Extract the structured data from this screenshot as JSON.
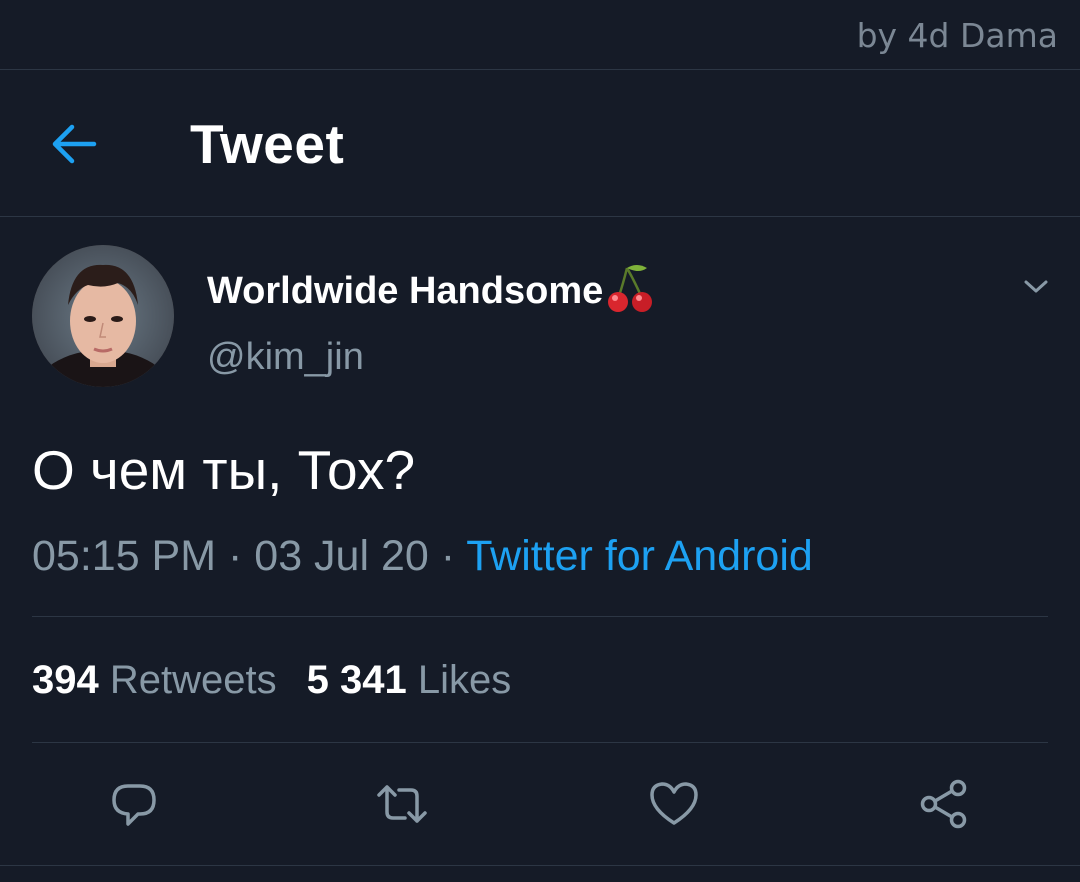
{
  "watermark": "by 4d Dama",
  "header": {
    "title": "Tweet",
    "back_icon": "arrow-left-icon"
  },
  "author": {
    "display_name": "Worldwide Handsome",
    "emoji": "cherries",
    "handle": "@kim_jin"
  },
  "tweet": {
    "text": "О чем ты, Тох?",
    "time": "05:15 PM",
    "separator": " · ",
    "date": "03 Jul 20",
    "source": "Twitter for Android"
  },
  "stats": {
    "retweets_count": "394",
    "retweets_label": "Retweets",
    "likes_count": "5 341",
    "likes_label": "Likes"
  },
  "actions": [
    "reply-icon",
    "retweet-icon",
    "like-icon",
    "share-icon"
  ],
  "colors": {
    "background": "#151b27",
    "accent": "#1da1f2",
    "secondary_text": "#8899a6",
    "divider": "#2c3644"
  }
}
